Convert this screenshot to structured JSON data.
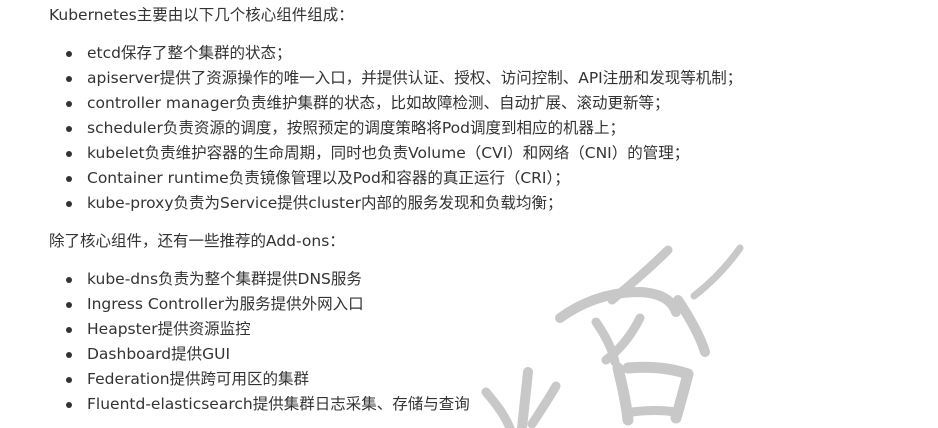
{
  "intro": "Kubernetes主要由以下几个核心组件组成：",
  "core_components": [
    "etcd保存了整个集群的状态；",
    "apiserver提供了资源操作的唯一入口，并提供认证、授权、访问控制、API注册和发现等机制；",
    "controller manager负责维护集群的状态，比如故障检测、自动扩展、滚动更新等；",
    "scheduler负责资源的调度，按照预定的调度策略将Pod调度到相应的机器上；",
    "kubelet负责维护容器的生命周期，同时也负责Volume（CVI）和网络（CNI）的管理；",
    "Container runtime负责镜像管理以及Pod和容器的真正运行（CRI）；",
    "kube-proxy负责为Service提供cluster内部的服务发现和负载均衡；"
  ],
  "addons_intro": "除了核心组件，还有一些推荐的Add-ons：",
  "addons": [
    "kube-dns负责为整个集群提供DNS服务",
    "Ingress Controller为服务提供外网入口",
    "Heapster提供资源监控",
    "Dashboard提供GUI",
    "Federation提供跨可用区的集群",
    "Fluentd-elasticsearch提供集群日志采集、存储与查询"
  ],
  "watermark": {
    "color": "#c8c8c8"
  }
}
